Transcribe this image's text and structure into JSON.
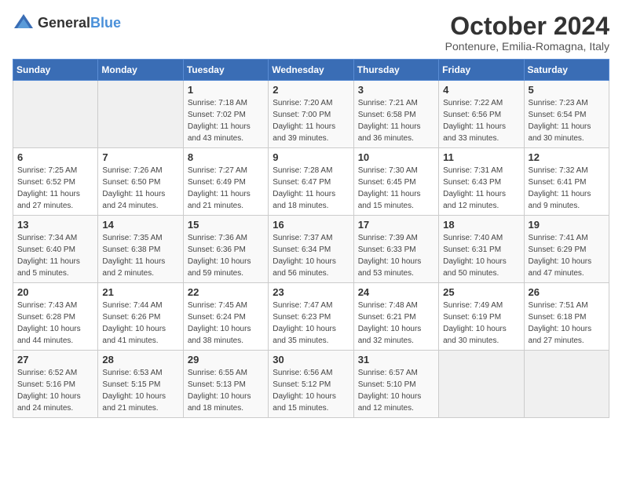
{
  "header": {
    "logo": {
      "general": "General",
      "blue": "Blue"
    },
    "title": "October 2024",
    "subtitle": "Pontenure, Emilia-Romagna, Italy"
  },
  "days_of_week": [
    "Sunday",
    "Monday",
    "Tuesday",
    "Wednesday",
    "Thursday",
    "Friday",
    "Saturday"
  ],
  "weeks": [
    [
      {
        "day": "",
        "sunrise": "",
        "sunset": "",
        "daylight": ""
      },
      {
        "day": "",
        "sunrise": "",
        "sunset": "",
        "daylight": ""
      },
      {
        "day": "1",
        "sunrise": "Sunrise: 7:18 AM",
        "sunset": "Sunset: 7:02 PM",
        "daylight": "Daylight: 11 hours and 43 minutes."
      },
      {
        "day": "2",
        "sunrise": "Sunrise: 7:20 AM",
        "sunset": "Sunset: 7:00 PM",
        "daylight": "Daylight: 11 hours and 39 minutes."
      },
      {
        "day": "3",
        "sunrise": "Sunrise: 7:21 AM",
        "sunset": "Sunset: 6:58 PM",
        "daylight": "Daylight: 11 hours and 36 minutes."
      },
      {
        "day": "4",
        "sunrise": "Sunrise: 7:22 AM",
        "sunset": "Sunset: 6:56 PM",
        "daylight": "Daylight: 11 hours and 33 minutes."
      },
      {
        "day": "5",
        "sunrise": "Sunrise: 7:23 AM",
        "sunset": "Sunset: 6:54 PM",
        "daylight": "Daylight: 11 hours and 30 minutes."
      }
    ],
    [
      {
        "day": "6",
        "sunrise": "Sunrise: 7:25 AM",
        "sunset": "Sunset: 6:52 PM",
        "daylight": "Daylight: 11 hours and 27 minutes."
      },
      {
        "day": "7",
        "sunrise": "Sunrise: 7:26 AM",
        "sunset": "Sunset: 6:50 PM",
        "daylight": "Daylight: 11 hours and 24 minutes."
      },
      {
        "day": "8",
        "sunrise": "Sunrise: 7:27 AM",
        "sunset": "Sunset: 6:49 PM",
        "daylight": "Daylight: 11 hours and 21 minutes."
      },
      {
        "day": "9",
        "sunrise": "Sunrise: 7:28 AM",
        "sunset": "Sunset: 6:47 PM",
        "daylight": "Daylight: 11 hours and 18 minutes."
      },
      {
        "day": "10",
        "sunrise": "Sunrise: 7:30 AM",
        "sunset": "Sunset: 6:45 PM",
        "daylight": "Daylight: 11 hours and 15 minutes."
      },
      {
        "day": "11",
        "sunrise": "Sunrise: 7:31 AM",
        "sunset": "Sunset: 6:43 PM",
        "daylight": "Daylight: 11 hours and 12 minutes."
      },
      {
        "day": "12",
        "sunrise": "Sunrise: 7:32 AM",
        "sunset": "Sunset: 6:41 PM",
        "daylight": "Daylight: 11 hours and 9 minutes."
      }
    ],
    [
      {
        "day": "13",
        "sunrise": "Sunrise: 7:34 AM",
        "sunset": "Sunset: 6:40 PM",
        "daylight": "Daylight: 11 hours and 5 minutes."
      },
      {
        "day": "14",
        "sunrise": "Sunrise: 7:35 AM",
        "sunset": "Sunset: 6:38 PM",
        "daylight": "Daylight: 11 hours and 2 minutes."
      },
      {
        "day": "15",
        "sunrise": "Sunrise: 7:36 AM",
        "sunset": "Sunset: 6:36 PM",
        "daylight": "Daylight: 10 hours and 59 minutes."
      },
      {
        "day": "16",
        "sunrise": "Sunrise: 7:37 AM",
        "sunset": "Sunset: 6:34 PM",
        "daylight": "Daylight: 10 hours and 56 minutes."
      },
      {
        "day": "17",
        "sunrise": "Sunrise: 7:39 AM",
        "sunset": "Sunset: 6:33 PM",
        "daylight": "Daylight: 10 hours and 53 minutes."
      },
      {
        "day": "18",
        "sunrise": "Sunrise: 7:40 AM",
        "sunset": "Sunset: 6:31 PM",
        "daylight": "Daylight: 10 hours and 50 minutes."
      },
      {
        "day": "19",
        "sunrise": "Sunrise: 7:41 AM",
        "sunset": "Sunset: 6:29 PM",
        "daylight": "Daylight: 10 hours and 47 minutes."
      }
    ],
    [
      {
        "day": "20",
        "sunrise": "Sunrise: 7:43 AM",
        "sunset": "Sunset: 6:28 PM",
        "daylight": "Daylight: 10 hours and 44 minutes."
      },
      {
        "day": "21",
        "sunrise": "Sunrise: 7:44 AM",
        "sunset": "Sunset: 6:26 PM",
        "daylight": "Daylight: 10 hours and 41 minutes."
      },
      {
        "day": "22",
        "sunrise": "Sunrise: 7:45 AM",
        "sunset": "Sunset: 6:24 PM",
        "daylight": "Daylight: 10 hours and 38 minutes."
      },
      {
        "day": "23",
        "sunrise": "Sunrise: 7:47 AM",
        "sunset": "Sunset: 6:23 PM",
        "daylight": "Daylight: 10 hours and 35 minutes."
      },
      {
        "day": "24",
        "sunrise": "Sunrise: 7:48 AM",
        "sunset": "Sunset: 6:21 PM",
        "daylight": "Daylight: 10 hours and 32 minutes."
      },
      {
        "day": "25",
        "sunrise": "Sunrise: 7:49 AM",
        "sunset": "Sunset: 6:19 PM",
        "daylight": "Daylight: 10 hours and 30 minutes."
      },
      {
        "day": "26",
        "sunrise": "Sunrise: 7:51 AM",
        "sunset": "Sunset: 6:18 PM",
        "daylight": "Daylight: 10 hours and 27 minutes."
      }
    ],
    [
      {
        "day": "27",
        "sunrise": "Sunrise: 6:52 AM",
        "sunset": "Sunset: 5:16 PM",
        "daylight": "Daylight: 10 hours and 24 minutes."
      },
      {
        "day": "28",
        "sunrise": "Sunrise: 6:53 AM",
        "sunset": "Sunset: 5:15 PM",
        "daylight": "Daylight: 10 hours and 21 minutes."
      },
      {
        "day": "29",
        "sunrise": "Sunrise: 6:55 AM",
        "sunset": "Sunset: 5:13 PM",
        "daylight": "Daylight: 10 hours and 18 minutes."
      },
      {
        "day": "30",
        "sunrise": "Sunrise: 6:56 AM",
        "sunset": "Sunset: 5:12 PM",
        "daylight": "Daylight: 10 hours and 15 minutes."
      },
      {
        "day": "31",
        "sunrise": "Sunrise: 6:57 AM",
        "sunset": "Sunset: 5:10 PM",
        "daylight": "Daylight: 10 hours and 12 minutes."
      },
      {
        "day": "",
        "sunrise": "",
        "sunset": "",
        "daylight": ""
      },
      {
        "day": "",
        "sunrise": "",
        "sunset": "",
        "daylight": ""
      }
    ]
  ]
}
